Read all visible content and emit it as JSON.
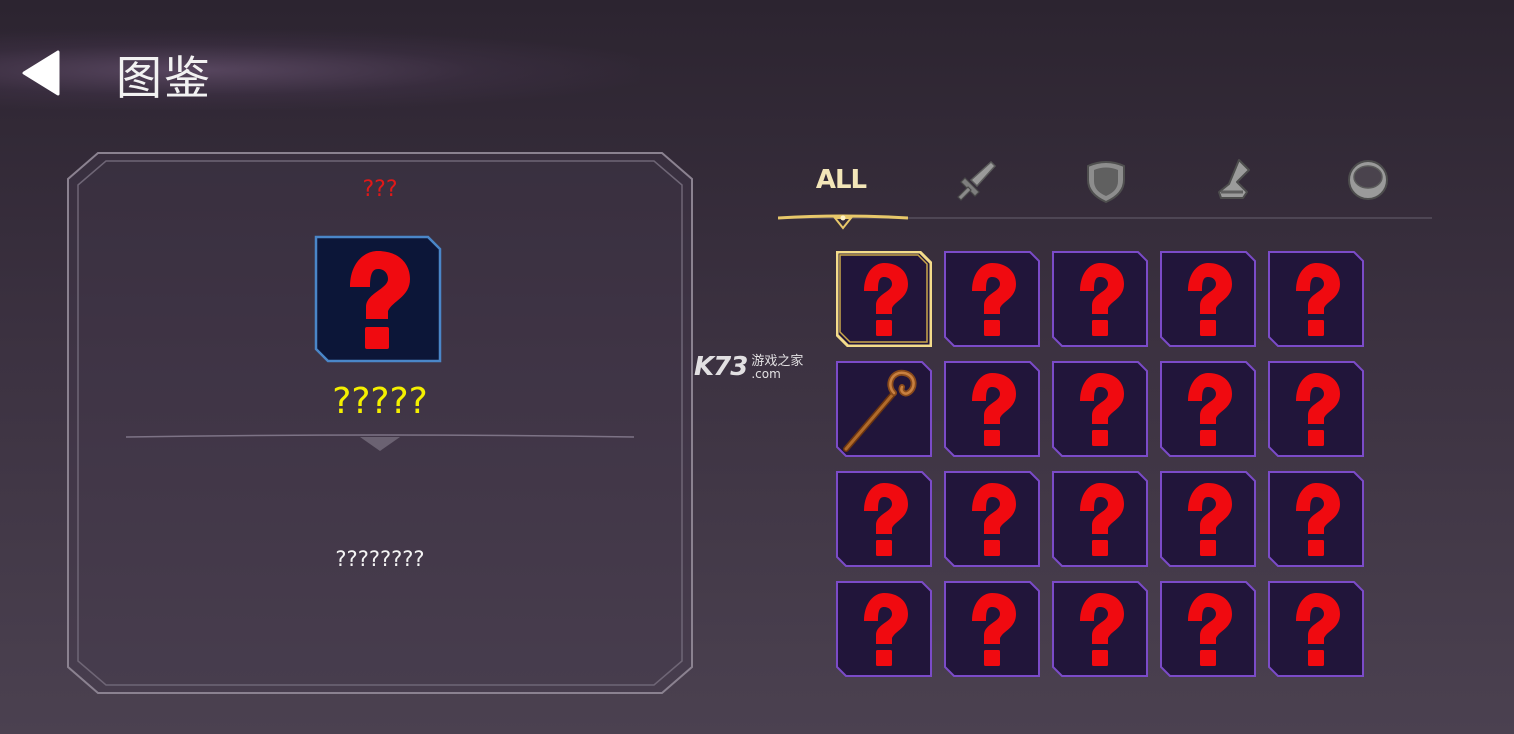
{
  "header": {
    "title": "图鉴",
    "back_icon": "back-arrow-icon"
  },
  "detail": {
    "rarity_text": "???",
    "rarity_color": "#e01818",
    "name": "?????",
    "name_color": "#f4f000",
    "description": "????????",
    "preview_icon": "question-mark-icon"
  },
  "tabs": [
    {
      "id": "all",
      "label": "ALL",
      "selected": true
    },
    {
      "id": "weapon",
      "icon": "sword-icon",
      "selected": false
    },
    {
      "id": "armor",
      "icon": "shield-icon",
      "selected": false
    },
    {
      "id": "boots",
      "icon": "boot-icon",
      "selected": false
    },
    {
      "id": "ring",
      "icon": "ring-icon",
      "selected": false
    }
  ],
  "colors": {
    "accent_gold": "#e8c86a",
    "slot_bg": "#21153a",
    "slot_border": "#7b4bc8",
    "preview_bg": "#0c1638",
    "preview_border": "#4a86c8",
    "question_red": "#f00a10"
  },
  "grid": {
    "items": [
      {
        "icon": "question-mark-icon",
        "selected": true
      },
      {
        "icon": "question-mark-icon"
      },
      {
        "icon": "question-mark-icon"
      },
      {
        "icon": "question-mark-icon"
      },
      {
        "icon": "question-mark-icon"
      },
      {
        "icon": "wooden-staff-icon"
      },
      {
        "icon": "question-mark-icon"
      },
      {
        "icon": "question-mark-icon"
      },
      {
        "icon": "question-mark-icon"
      },
      {
        "icon": "question-mark-icon"
      },
      {
        "icon": "question-mark-icon"
      },
      {
        "icon": "question-mark-icon"
      },
      {
        "icon": "question-mark-icon"
      },
      {
        "icon": "question-mark-icon"
      },
      {
        "icon": "question-mark-icon"
      },
      {
        "icon": "question-mark-icon"
      },
      {
        "icon": "question-mark-icon"
      },
      {
        "icon": "question-mark-icon"
      },
      {
        "icon": "question-mark-icon"
      },
      {
        "icon": "question-mark-icon"
      }
    ]
  },
  "watermark": {
    "brand": "K73",
    "cn": "游戏之家",
    "domain": ".com"
  }
}
